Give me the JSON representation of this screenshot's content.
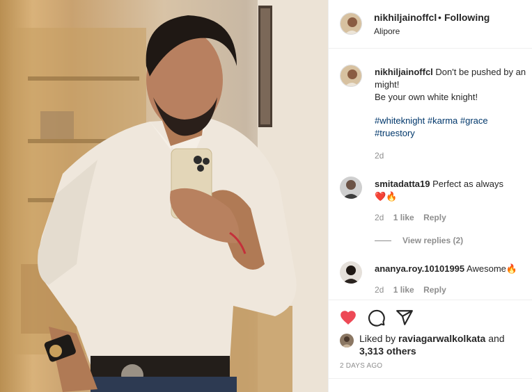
{
  "post": {
    "author": "nikhiljainoffcl",
    "separator": "•",
    "follow_status": "Following",
    "location": "Alipore"
  },
  "caption": {
    "username": "nikhiljainoffcl",
    "line1": "Don't be pushed by an",
    "line2": "might!",
    "line3": "Be your own white knight!",
    "tags": [
      "#whiteknight",
      "#karma",
      "#grace",
      "#truestory"
    ],
    "time": "2d"
  },
  "comments": [
    {
      "username": "smitadatta19",
      "text": "Perfect as always",
      "emoji": "❤️🔥",
      "time": "2d",
      "likes": "1 like",
      "reply": "Reply",
      "view_replies": "View replies (2)"
    },
    {
      "username": "ananya.roy.10101995",
      "text": "Awesome🔥",
      "time": "2d",
      "likes": "1 like",
      "reply": "Reply"
    }
  ],
  "likes": {
    "prefix": "Liked by",
    "user": "raviagarwalkolkata",
    "and": "and",
    "others": "3,313 others"
  },
  "posted_ago": "2 DAYS AGO",
  "icons": {
    "like": "heart-filled-icon",
    "comment": "comment-icon",
    "share": "share-plane-icon"
  },
  "colors": {
    "like_red": "#ed4956",
    "hashtag": "#00376b",
    "muted": "#8e8e8e",
    "text": "#262626"
  }
}
